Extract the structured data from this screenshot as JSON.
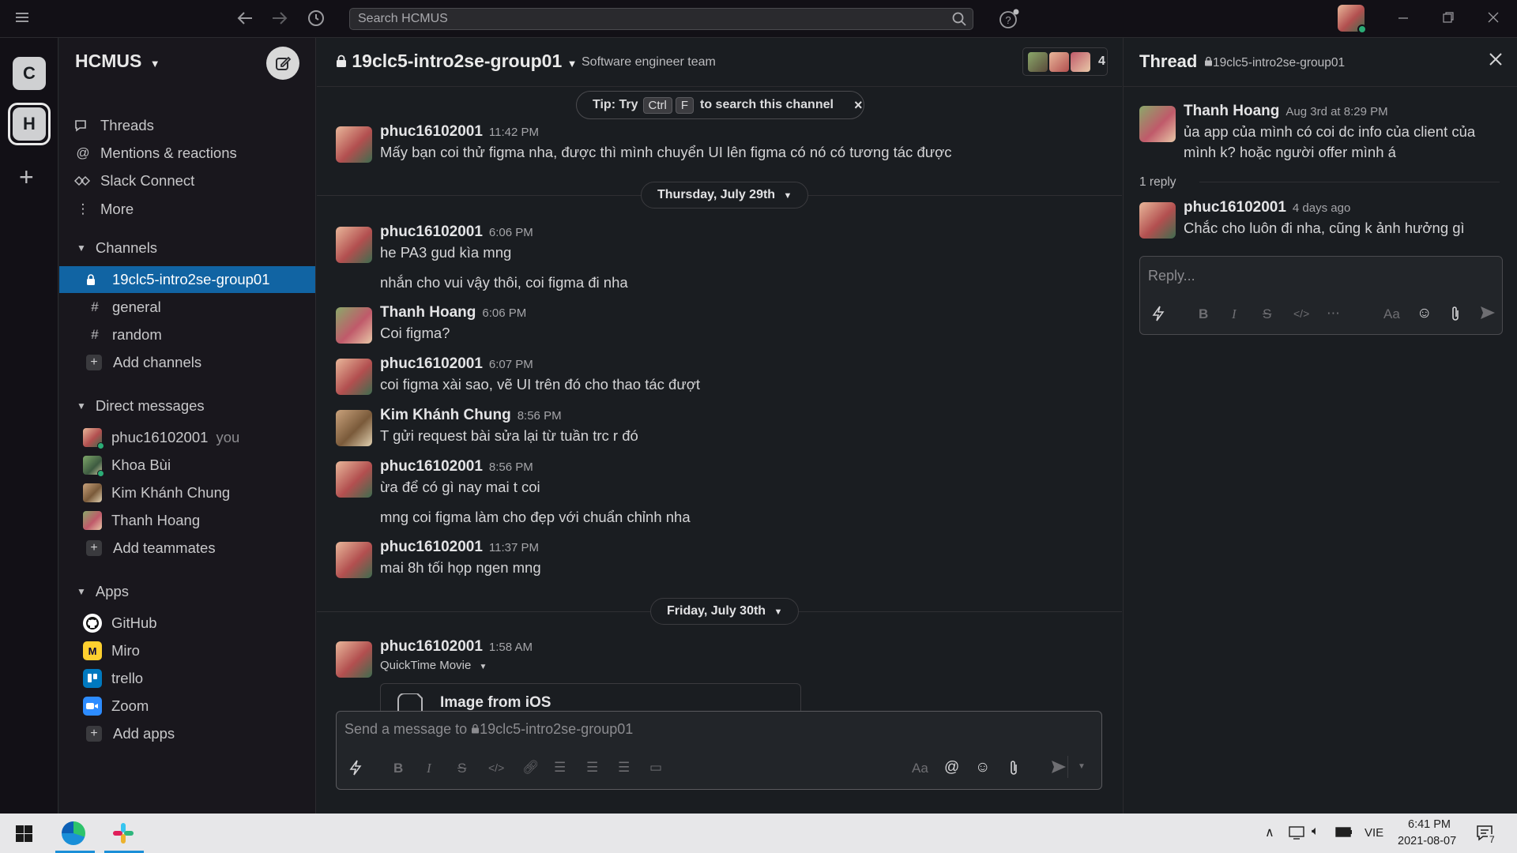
{
  "topbar": {
    "search_placeholder": "Search HCMUS"
  },
  "rail": {
    "workspaces": [
      "C",
      "H"
    ],
    "add": "+"
  },
  "sidebar": {
    "workspace_name": "HCMUS",
    "nav": [
      "Threads",
      "Mentions & reactions",
      "Slack Connect",
      "More"
    ],
    "channels_header": "Channels",
    "channels": [
      "19clc5-intro2se-group01",
      "general",
      "random"
    ],
    "add_channels": "Add channels",
    "dm_header": "Direct messages",
    "dms": [
      "phuc16102001",
      "Khoa Bùi",
      "Kim Khánh Chung",
      "Thanh Hoang"
    ],
    "you_label": "you",
    "add_teammates": "Add teammates",
    "apps_header": "Apps",
    "apps": [
      "GitHub",
      "Miro",
      "trello",
      "Zoom"
    ],
    "add_apps": "Add apps"
  },
  "channel": {
    "name": "19clc5-intro2se-group01",
    "topic": "Software engineer team",
    "member_count": "4"
  },
  "tip": {
    "prefix": "Tip: Try",
    "key1": "Ctrl",
    "key2": "F",
    "suffix": "to search this channel"
  },
  "messages": {
    "m1": {
      "author": "phuc16102001",
      "time": "11:42 PM",
      "text": "Mấy bạn coi thử figma nha, được thì mình chuyển UI lên figma có nó có tương tác được"
    },
    "date1": "Thursday, July 29th",
    "m2": {
      "author": "phuc16102001",
      "time": "6:06 PM",
      "text": "he PA3 gud kìa mng",
      "cont": "nhắn cho vui vậy thôi, coi figma đi nha"
    },
    "m3": {
      "author": "Thanh Hoang",
      "time": "6:06 PM",
      "text": "Coi figma?"
    },
    "m4": {
      "author": "phuc16102001",
      "time": "6:07 PM",
      "text": "coi figma xài sao, vẽ UI trên đó cho thao tác đượt"
    },
    "m5": {
      "author": "Kim Khánh Chung",
      "time": "8:56 PM",
      "text": "T gửi request bài sửa lại từ tuần trc r đó"
    },
    "m6": {
      "author": "phuc16102001",
      "time": "8:56 PM",
      "text": "ừa để có gì nay mai t coi",
      "cont": "mng coi figma làm cho đẹp với chuẩn chỉnh nha"
    },
    "m7": {
      "author": "phuc16102001",
      "time": "11:37 PM",
      "text": "mai 8h tối họp ngen mng"
    },
    "date2": "Friday, July 30th",
    "m8": {
      "author": "phuc16102001",
      "time": "1:58 AM",
      "file_type": "QuickTime Movie",
      "file_name": "Image from iOS"
    }
  },
  "composer": {
    "placeholder_prefix": "Send a message to",
    "channel": "19clc5-intro2se-group01"
  },
  "thread": {
    "title": "Thread",
    "channel": "19clc5-intro2se-group01",
    "parent": {
      "author": "Thanh Hoang",
      "time": "Aug 3rd at 8:29 PM",
      "line1": "ủa app của mình có coi dc info của client của",
      "line2": "mình k? hoặc người offer mình á"
    },
    "reply_count": "1 reply",
    "reply": {
      "author": "phuc16102001",
      "time": "4 days ago",
      "text": "Chắc cho luôn đi nha, cũng k ảnh hưởng gì"
    },
    "reply_placeholder": "Reply..."
  },
  "taskbar": {
    "lang": "VIE",
    "time": "6:41 PM",
    "date": "2021-08-07",
    "notif_count": "7"
  },
  "colors": {
    "accent": "#1164a3",
    "sidebar": "#19171d",
    "background": "#1a1d21",
    "online": "#2bac76"
  }
}
